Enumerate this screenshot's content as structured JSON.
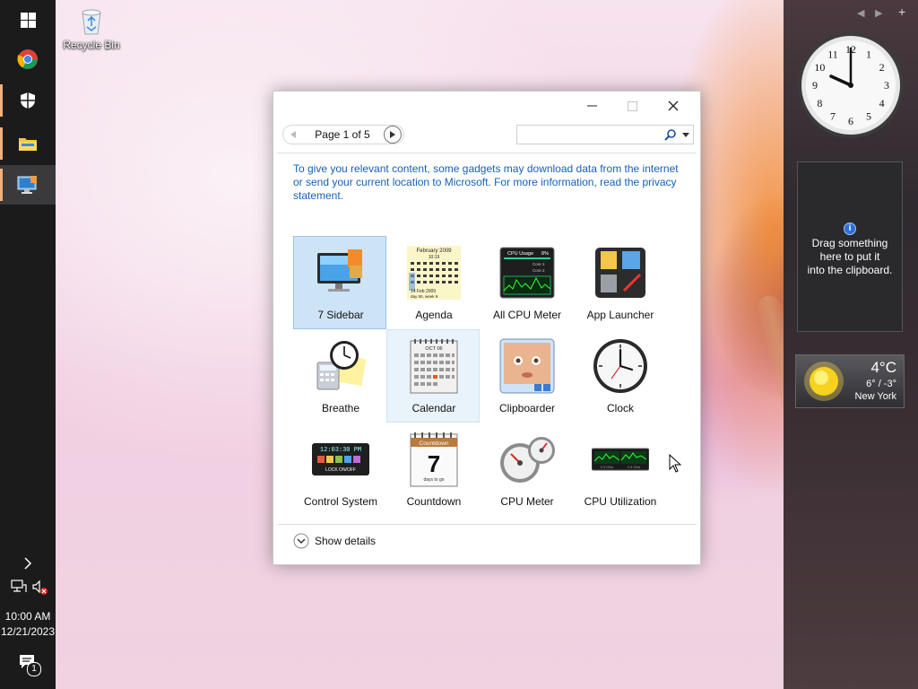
{
  "desktop": {
    "recycle_bin_label": "Recycle Bin"
  },
  "taskbar": {
    "items": [
      {
        "name": "start",
        "icon": "windows-logo-icon"
      },
      {
        "name": "chrome",
        "icon": "chrome-icon"
      },
      {
        "name": "security",
        "icon": "shield-icon"
      },
      {
        "name": "file-explorer",
        "icon": "folder-icon"
      },
      {
        "name": "desktop-gadgets",
        "icon": "monitor-icon"
      }
    ],
    "tray": {
      "expand_icon": "chevron-right-icon",
      "network_icon": "network-icon",
      "volume_icon": "volume-muted-icon",
      "time": "10:00 AM",
      "date": "12/21/2023",
      "notification_count": "1"
    }
  },
  "gadget_window": {
    "page_label": "Page 1 of 5",
    "search_placeholder": "",
    "notice": "To give you relevant content, some gadgets may download data from the internet or send your current location to Microsoft. For more information, read the privacy statement.",
    "gadgets": [
      {
        "label": "7 Sidebar",
        "icon": "sidebar-icon",
        "state": "selected"
      },
      {
        "label": "Agenda",
        "icon": "agenda-icon",
        "state": ""
      },
      {
        "label": "All CPU Meter",
        "icon": "cpu-graph-icon",
        "state": ""
      },
      {
        "label": "App Launcher",
        "icon": "app-launcher-icon",
        "state": ""
      },
      {
        "label": "Breathe",
        "icon": "breathe-icon",
        "state": ""
      },
      {
        "label": "Calendar",
        "icon": "calendar-icon",
        "state": "hover"
      },
      {
        "label": "Clipboarder",
        "icon": "clipboarder-icon",
        "state": ""
      },
      {
        "label": "Clock",
        "icon": "clock-icon",
        "state": ""
      },
      {
        "label": "Control System",
        "icon": "control-system-icon",
        "state": ""
      },
      {
        "label": "Countdown",
        "icon": "countdown-icon",
        "state": ""
      },
      {
        "label": "CPU Meter",
        "icon": "cpu-meter-icon",
        "state": ""
      },
      {
        "label": "CPU Utilization",
        "icon": "cpu-utilization-icon",
        "state": ""
      }
    ],
    "show_details_label": "Show details",
    "thumbnail_text": {
      "agenda_month": "February 2009",
      "agenda_time": "10:19",
      "agenda_footer": "14 Feb 2009",
      "agenda_footer2": "day 50, week 8",
      "cpu_usage_title": "CPU Usage",
      "cpu_usage_pct": "8%",
      "cpu_core1": "Core 1",
      "cpu_core2": "Core 2",
      "calendar_month": "OCT 06",
      "control_time": "12:03:30 PM",
      "control_lock": "LOCK ON/OFF",
      "countdown_title": "Countdown",
      "countdown_number": "7",
      "countdown_caption": "days to go",
      "cpu_util_left": "2.3 GHz",
      "cpu_util_right": "2.3 GHz"
    }
  },
  "sidebar": {
    "nav_prev": "◀",
    "nav_next": "▶",
    "add": "+",
    "clock_numbers": [
      "12",
      "1",
      "2",
      "3",
      "4",
      "5",
      "6",
      "7",
      "8",
      "9",
      "10",
      "11"
    ],
    "clipboard_text_1": "Drag something",
    "clipboard_text_2": "here to put it",
    "clipboard_text_3": "into the clipboard.",
    "weather_temp": "4°C",
    "weather_range": "6° / -3°",
    "weather_city": "New York"
  },
  "colors": {
    "taskbar_bg": "#1b1b1c",
    "accent": "#1560b8",
    "selection": "#cde4f7"
  }
}
